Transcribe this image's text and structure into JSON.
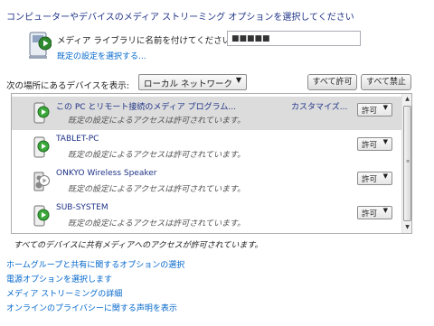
{
  "heading": "コンピューターやデバイスのメディア ストリーミング オプションを選択してください",
  "library": {
    "label": "メディア ライブラリに名前を付けてください:",
    "name_value": "■■■■■",
    "choose_default_link": "既定の設定を選択する..."
  },
  "filter": {
    "label": "次の場所にあるデバイスを表示:",
    "selected": "ローカル ネットワーク",
    "allow_all": "すべて許可",
    "block_all": "すべて禁止"
  },
  "devices": [
    {
      "name": "この PC とリモート接続のメディア プログラム...",
      "status": "既定の設定によるアクセスは許可されています。",
      "customize": "カスタマイズ...",
      "access": "許可",
      "icon": "media-device-icon"
    },
    {
      "name": "TABLET-PC",
      "status": "既定の設定によるアクセスは許可されています。",
      "access": "許可",
      "icon": "media-device-icon"
    },
    {
      "name": "ONKYO Wireless Speaker",
      "status": "既定の設定によるアクセスは許可されています。",
      "access": "許可",
      "icon": "speaker-device-icon"
    },
    {
      "name": "SUB-SYSTEM",
      "status": "既定の設定によるアクセスは許可されています。",
      "access": "許可",
      "icon": "media-device-icon"
    }
  ],
  "all_allowed_note": "すべてのデバイスに共有メディアへのアクセスが許可されています。",
  "links": [
    "ホームグループと共有に関するオプションの選択",
    "電源オプションを選択します",
    "メディア ストリーミングの詳細",
    "オンラインのプライバシーに関する声明を表示"
  ],
  "colors": {
    "heading": "#1e3287",
    "link": "#0066cc",
    "selected_row": "#dcdcdc",
    "device_green": "#3aa83a"
  }
}
